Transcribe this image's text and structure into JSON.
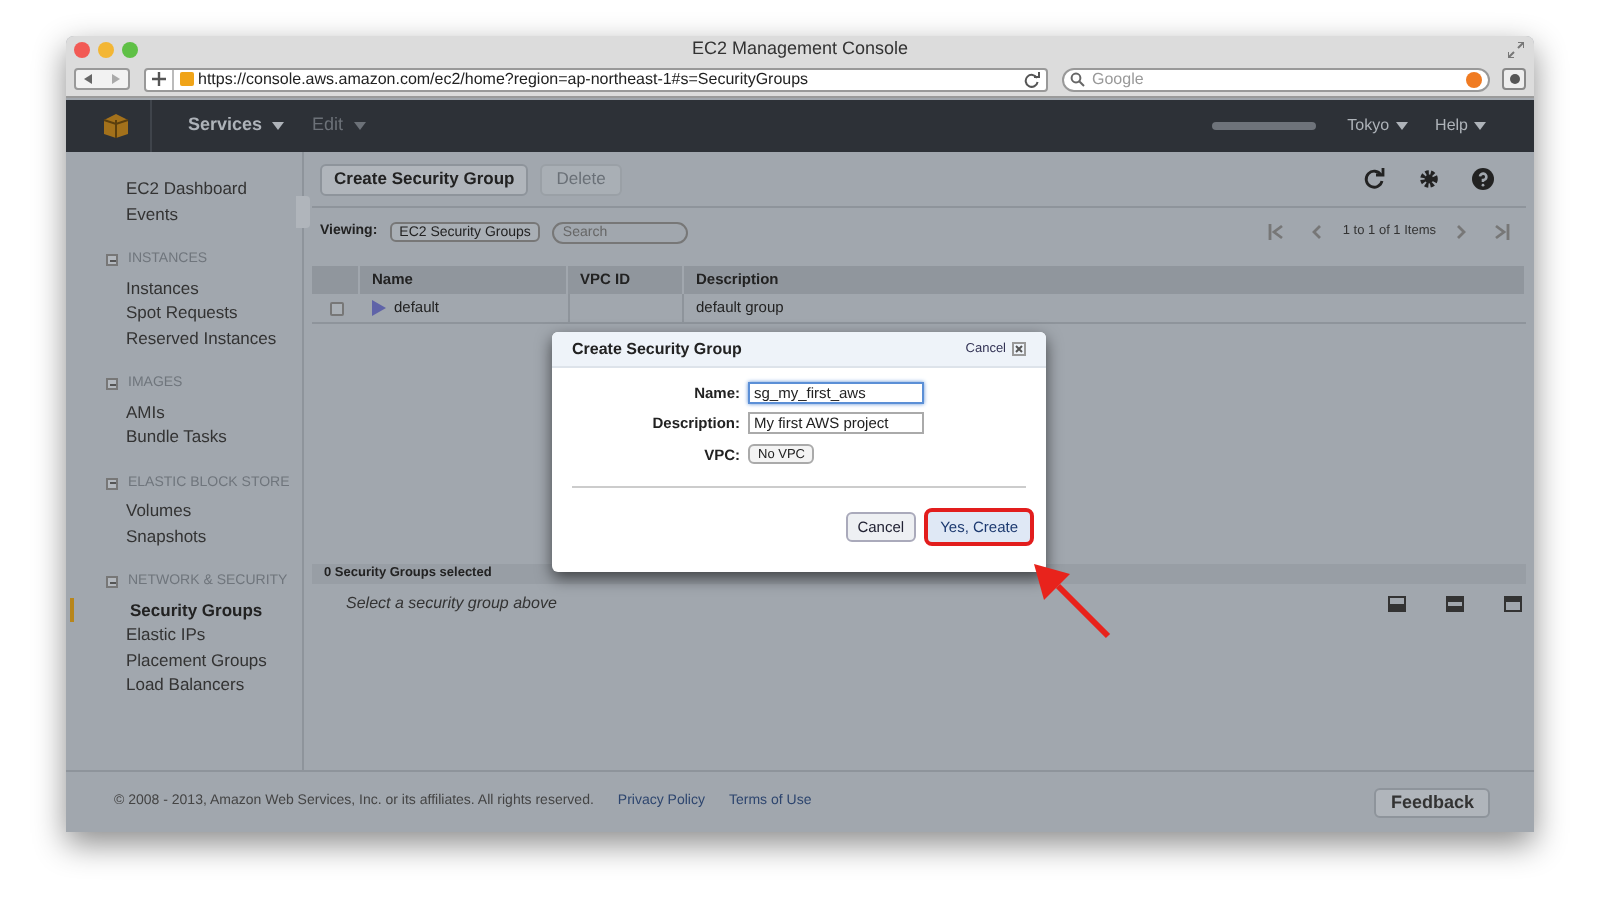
{
  "window": {
    "title": "EC2 Management Console"
  },
  "browser": {
    "url": "https://console.aws.amazon.com/ec2/home?region=ap-northeast-1#s=SecurityGroups",
    "search_placeholder": "Google"
  },
  "nav": {
    "menus": [
      {
        "label": "Services",
        "disabled": false
      },
      {
        "label": "Edit",
        "disabled": true
      }
    ],
    "right": [
      "Tokyo",
      "Help"
    ]
  },
  "sidebar": {
    "top": [
      {
        "label": "EC2 Dashboard",
        "selected": false
      },
      {
        "label": "Events",
        "selected": false
      }
    ],
    "sections": [
      {
        "title": "INSTANCES",
        "items": [
          {
            "label": "Instances",
            "selected": false
          },
          {
            "label": "Spot Requests",
            "selected": false
          },
          {
            "label": "Reserved Instances",
            "selected": false
          }
        ]
      },
      {
        "title": "IMAGES",
        "items": [
          {
            "label": "AMIs",
            "selected": false
          },
          {
            "label": "Bundle Tasks",
            "selected": false
          }
        ]
      },
      {
        "title": "ELASTIC BLOCK STORE",
        "items": [
          {
            "label": "Volumes",
            "selected": false
          },
          {
            "label": "Snapshots",
            "selected": false
          }
        ]
      },
      {
        "title": "NETWORK & SECURITY",
        "items": [
          {
            "label": "Security Groups",
            "selected": true
          },
          {
            "label": "Elastic IPs",
            "selected": false
          },
          {
            "label": "Placement Groups",
            "selected": false
          },
          {
            "label": "Load Balancers",
            "selected": false
          }
        ]
      }
    ]
  },
  "toolbar": {
    "buttons": [
      {
        "label": "Create Security Group",
        "disabled": false
      },
      {
        "label": "Delete",
        "disabled": true
      }
    ],
    "viewing_label": "Viewing:",
    "viewing_value": "EC2 Security Groups",
    "search_placeholder": "Search",
    "pagination": "1 to 1 of 1 Items"
  },
  "table": {
    "columns": [
      "Name",
      "VPC ID",
      "Description"
    ],
    "rows": [
      {
        "checked": false,
        "name": "default",
        "description": "default group"
      }
    ]
  },
  "details": {
    "title": "0 Security Groups selected",
    "message": "Select a security group above"
  },
  "footer": {
    "copyright": "© 2008 - 2013, Amazon Web Services, Inc. or its affiliates. All rights reserved.",
    "links": [
      "Privacy Policy",
      "Terms of Use"
    ],
    "feedback": "Feedback"
  },
  "dialog": {
    "title": "Create Security Group",
    "close": "Cancel",
    "fields": [
      {
        "label": "Name:",
        "kind": "text",
        "value": "sg_my_first_aws",
        "focused": true
      },
      {
        "label": "Description:",
        "kind": "text",
        "value": "My first AWS project",
        "focused": false
      },
      {
        "label": "VPC:",
        "kind": "select",
        "value": "No VPC"
      }
    ],
    "buttons": [
      {
        "label": "Cancel",
        "highlighted": false
      },
      {
        "label": "Yes, Create",
        "highlighted": true
      }
    ]
  }
}
